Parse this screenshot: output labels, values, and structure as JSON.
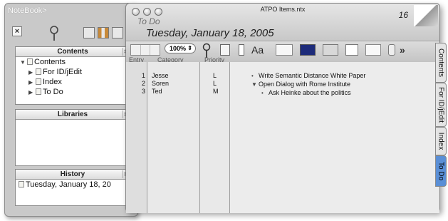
{
  "drawer": {
    "title": "NoteBook>",
    "close_label": "×",
    "contents": {
      "header": "Contents",
      "items": [
        {
          "label": "Contents",
          "expanded": true
        },
        {
          "label": "For ID/jEdit"
        },
        {
          "label": "Index"
        },
        {
          "label": "To Do"
        }
      ]
    },
    "libraries": {
      "header": "Libraries"
    },
    "history": {
      "header": "History",
      "items": [
        "Tuesday, January 18, 20"
      ]
    }
  },
  "window": {
    "title": "ATPO Items.ntx",
    "page_number": "16",
    "section": "To Do",
    "date": "Tuesday, January 18, 2005",
    "zoom": "100%",
    "columns": [
      "Entry",
      "Category",
      "Priority"
    ],
    "rows": [
      {
        "entry": "1",
        "category": "Jesse",
        "priority": "L"
      },
      {
        "entry": "2",
        "category": "Soren",
        "priority": "L"
      },
      {
        "entry": "3",
        "category": "Ted",
        "priority": "M"
      }
    ],
    "notes": [
      {
        "text": "Write Semantic Distance White Paper",
        "marker": "•",
        "indent": 0
      },
      {
        "text": "Open Dialog with Rome Institute",
        "marker": "▼",
        "indent": 0
      },
      {
        "text": "Ask Heinke about the politics",
        "marker": "•",
        "indent": 1
      }
    ],
    "toolbar": {
      "more": "»",
      "font_label": "Aa"
    }
  },
  "tabs": [
    {
      "label": "Contents",
      "active": false
    },
    {
      "label": "For ID/jEdit",
      "active": false
    },
    {
      "label": "Index",
      "active": false
    },
    {
      "label": "To Do",
      "active": true
    }
  ],
  "colors": {
    "active_tab": "#5a8fd6",
    "window_bg": "#d6d6d6"
  }
}
